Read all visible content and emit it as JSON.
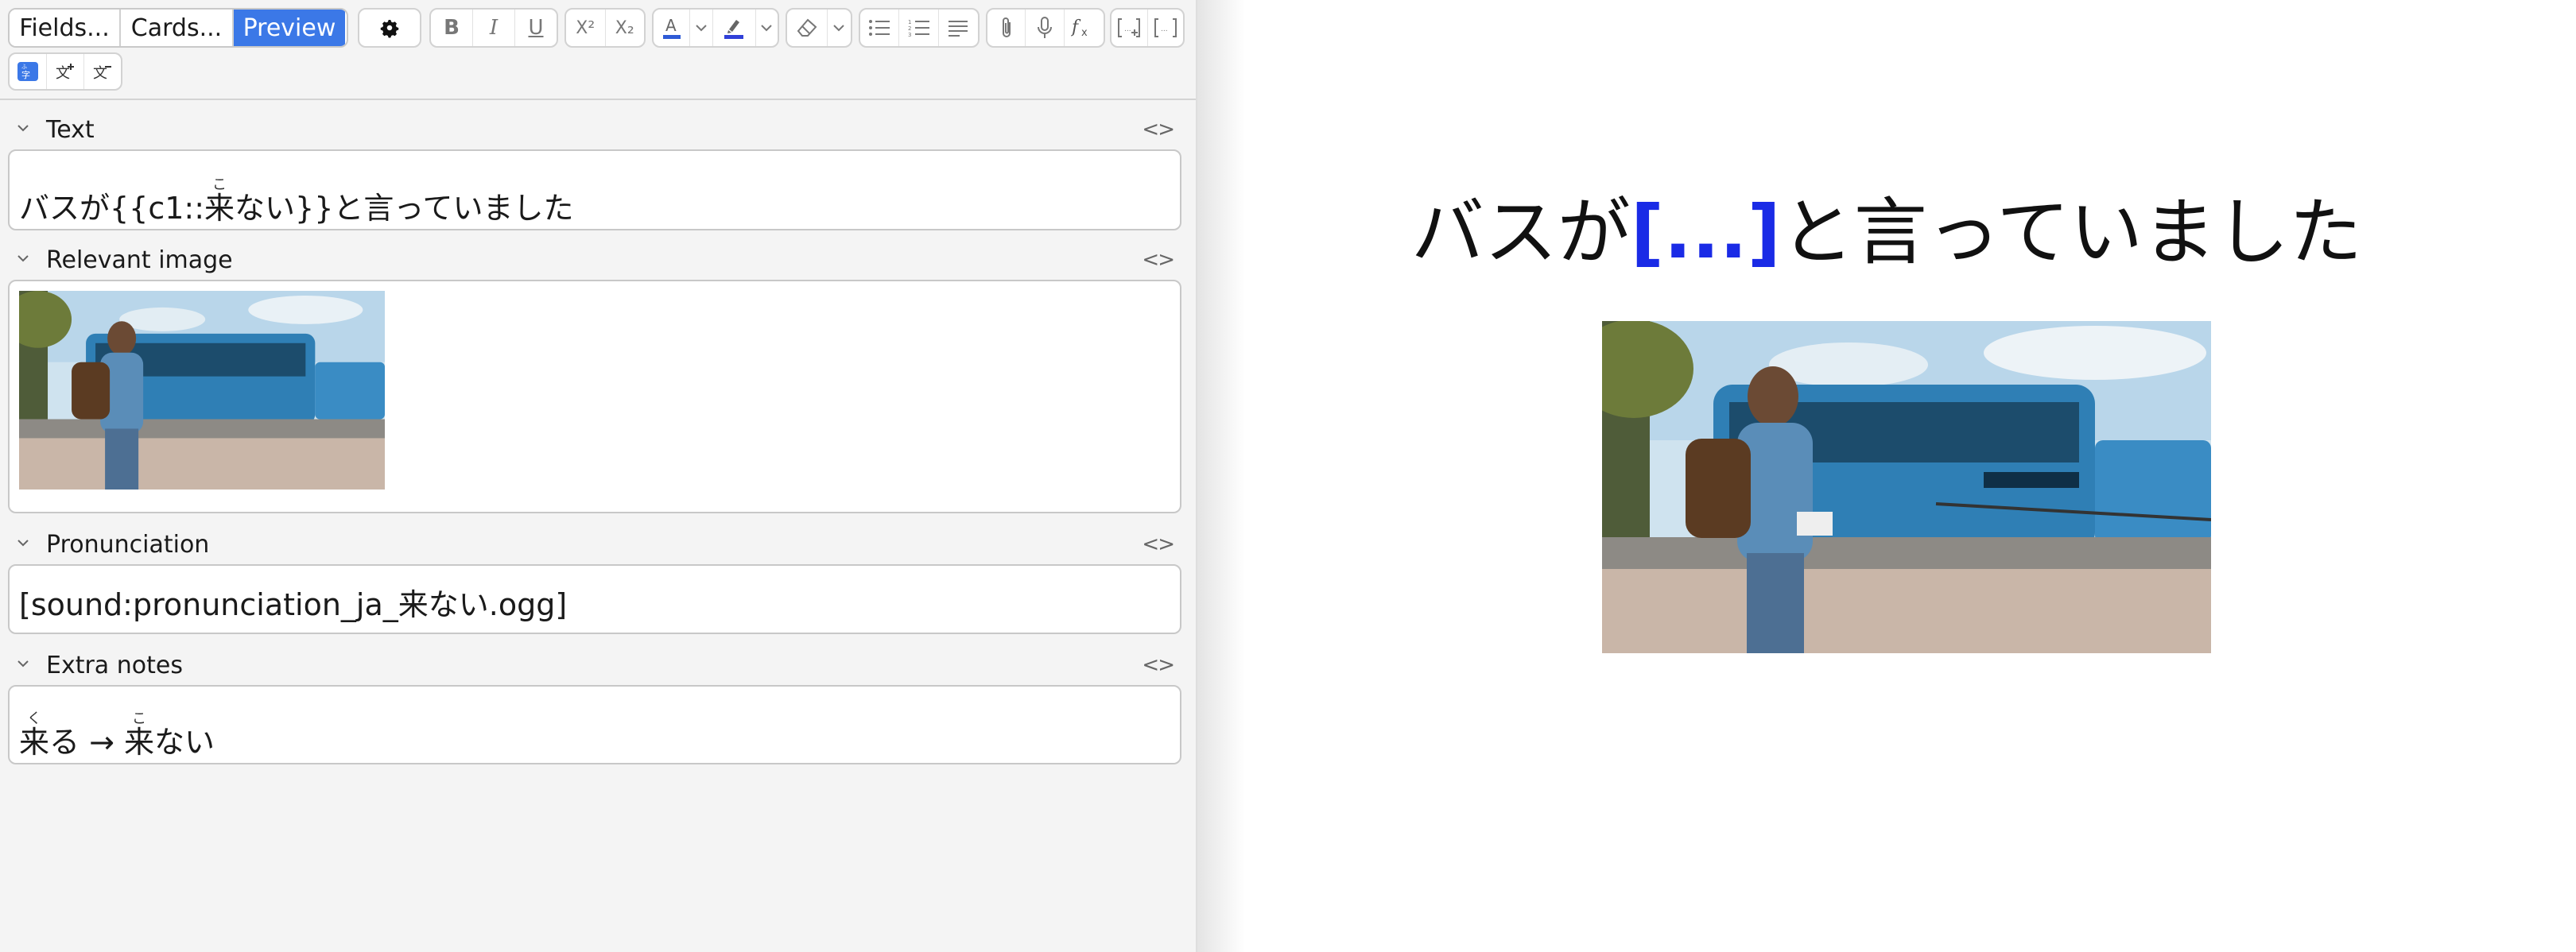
{
  "toolbar": {
    "fields_label": "Fields...",
    "cards_label": "Cards...",
    "preview_label": "Preview",
    "format_buttons": {
      "bold": "B",
      "italic": "I",
      "underline": "U",
      "superscript": "X²",
      "subscript": "X₂"
    },
    "text_color": "#2f5bd6",
    "highlight_color": "#3040d8"
  },
  "fields": [
    {
      "name": "Text",
      "value_prefix": "バスが{{c1::",
      "ruby_base": "来",
      "ruby_reading": "こ",
      "value_suffix": "ない}}と言っていました"
    },
    {
      "name": "Relevant image",
      "image_alt": "Man with backpack walking past blue buses"
    },
    {
      "name": "Pronunciation",
      "value": "[sound:pronunciation_ja_来ない.ogg]"
    },
    {
      "name": "Extra notes",
      "ruby1_base": "来",
      "ruby1_reading": "く",
      "text_mid": "る → ",
      "ruby2_base": "来",
      "ruby2_reading": "こ",
      "text_end": "ない"
    }
  ],
  "preview": {
    "before": "バスが",
    "cloze": "[...]",
    "after": "と言っていました",
    "cloze_color": "#1a2be6"
  },
  "colors": {
    "accent": "#3b78e7",
    "editor_bg": "#f4f4f4"
  }
}
